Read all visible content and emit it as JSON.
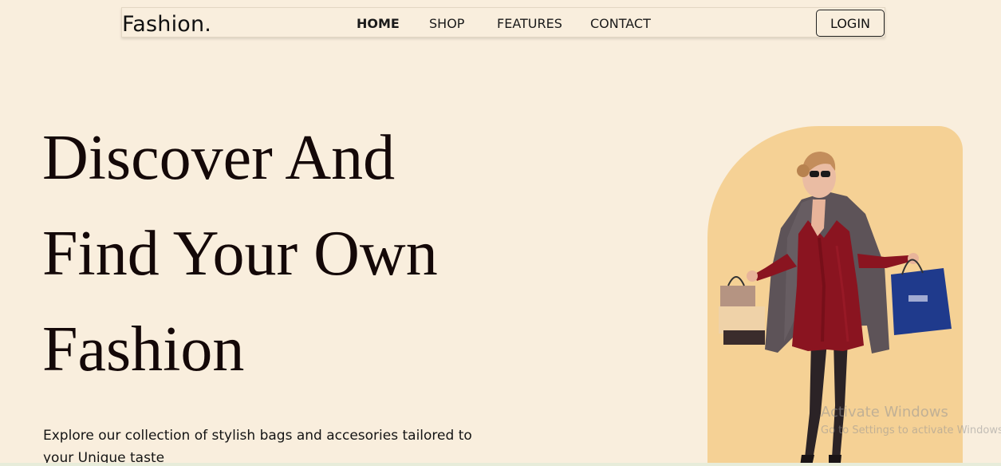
{
  "navbar": {
    "brand": "Fashion.",
    "links": [
      {
        "label": "HOME",
        "active": true
      },
      {
        "label": "SHOP",
        "active": false
      },
      {
        "label": "FEATURES",
        "active": false
      },
      {
        "label": "CONTACT",
        "active": false
      }
    ],
    "login_label": "LOGIN"
  },
  "hero": {
    "title_lines": [
      "Discover And",
      "Find Your Own",
      "Fashion"
    ],
    "description": "Explore our collection of stylish bags and accesories tailored to your Unique taste"
  },
  "watermark": {
    "line1": "Activate Windows",
    "line2": "Go to Settings to activate Windows."
  },
  "colors": {
    "background": "#f9eedd",
    "card": "#f5d195",
    "dress": "#8a1420",
    "coat": "#5a4f55",
    "bag_blue": "#1f3a8c"
  }
}
